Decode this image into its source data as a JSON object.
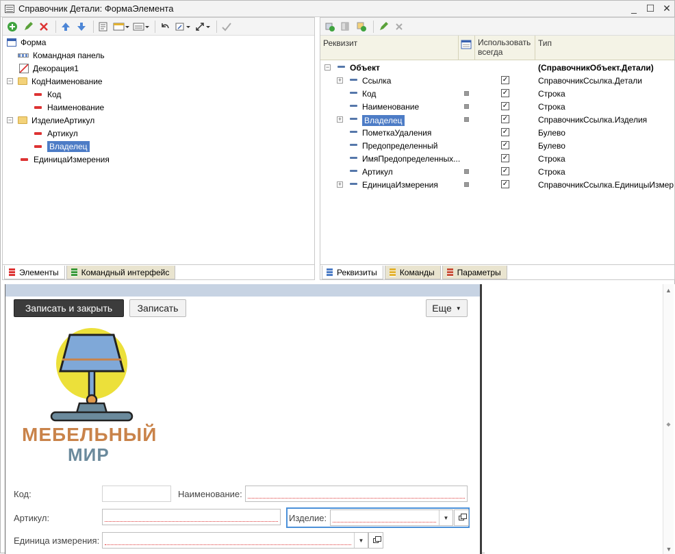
{
  "window": {
    "title": "Справочник Детали: ФормаЭлемента"
  },
  "elements_panel": {
    "tree": [
      {
        "label": "Форма"
      },
      {
        "label": "Командная панель"
      },
      {
        "label": "Декорация1"
      },
      {
        "label": "КодНаименование"
      },
      {
        "label": "Код"
      },
      {
        "label": "Наименование"
      },
      {
        "label": "ИзделиеАртикул"
      },
      {
        "label": "Артикул"
      },
      {
        "label": "Владелец"
      },
      {
        "label": "ЕдиницаИзмерения"
      }
    ],
    "tabs": [
      "Элементы",
      "Командный интерфейс"
    ]
  },
  "requisites_panel": {
    "headers": {
      "requisite": "Реквизит",
      "use_always": "Использовать всегда",
      "type": "Тип"
    },
    "rows": [
      {
        "name": "Объект",
        "type": "(СправочникОбъект.Детали)"
      },
      {
        "name": "Ссылка",
        "type": "СправочникСсылка.Детали"
      },
      {
        "name": "Код",
        "type": "Строка"
      },
      {
        "name": "Наименование",
        "type": "Строка"
      },
      {
        "name": "Владелец",
        "type": "СправочникСсылка.Изделия"
      },
      {
        "name": "ПометкаУдаления",
        "type": "Булево"
      },
      {
        "name": "Предопределенный",
        "type": "Булево"
      },
      {
        "name": "ИмяПредопределенных...",
        "type": "Строка"
      },
      {
        "name": "Артикул",
        "type": "Строка"
      },
      {
        "name": "ЕдиницаИзмерения",
        "type": "СправочникСсылка.ЕдиницыИзмере..."
      }
    ],
    "tabs": [
      "Реквизиты",
      "Команды",
      "Параметры"
    ]
  },
  "form_preview": {
    "write_close_label": "Записать и закрыть",
    "write_label": "Записать",
    "more_label": "Еще",
    "logo": {
      "line1": "МЕБЕЛЬНЫЙ",
      "line2": "МИР"
    },
    "fields": {
      "code_label": "Код:",
      "name_label": "Наименование:",
      "article_label": "Артикул:",
      "product_label": "Изделие:",
      "unit_label": "Единица измерения:"
    }
  },
  "colors": {
    "selection": "#4d7cc6",
    "dark_button": "#3c3c3c",
    "logo_orange": "#c9834a",
    "logo_blue": "#6b8a9c",
    "lamp_yellow": "#ece03a"
  }
}
